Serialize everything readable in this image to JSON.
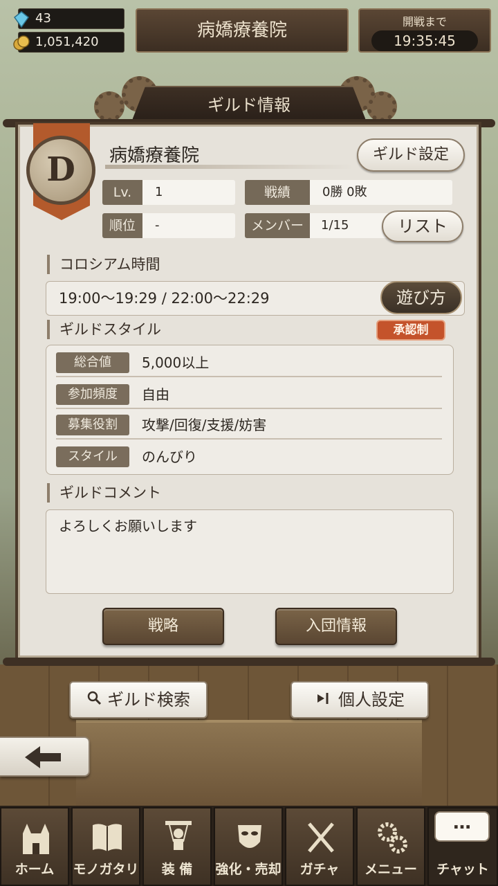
{
  "resources": {
    "gems": "43",
    "gold": "1,051,420"
  },
  "header": {
    "title": "病嬌療養院"
  },
  "timer": {
    "label": "開戦まで",
    "value": "19:35:45"
  },
  "panel": {
    "title": "ギルド情報",
    "rank": "D",
    "guild_name": "病嬌療養院",
    "settings_button": "ギルド設定",
    "stats": {
      "level_label": "Lv.",
      "level_value": "1",
      "record_label": "戦績",
      "record_value": "0勝 0敗",
      "rank_label": "順位",
      "rank_value": "-",
      "member_label": "メンバー",
      "member_value": "1/15"
    },
    "list_button": "リスト",
    "colosseum": {
      "title": "コロシアム時間",
      "times": "19:00〜19:29  /  22:00〜22:29",
      "howto_button": "遊び方"
    },
    "style": {
      "title": "ギルドスタイル",
      "badge": "承認制",
      "rows": [
        {
          "label": "総合値",
          "value": "5,000以上"
        },
        {
          "label": "参加頻度",
          "value": "自由"
        },
        {
          "label": "募集役割",
          "value": "攻撃/回復/支援/妨害"
        },
        {
          "label": "スタイル",
          "value": "のんびり"
        }
      ]
    },
    "comment": {
      "title": "ギルドコメント",
      "text": "よろしくお願いします"
    },
    "strategy_button": "戦略",
    "join_info_button": "入団情報"
  },
  "actions": {
    "search_button": "ギルド検索",
    "personal_button": "個人設定"
  },
  "nav": {
    "items": [
      {
        "label": "ホーム",
        "icon": "castle-icon"
      },
      {
        "label": "モノガタリ",
        "icon": "book-icon"
      },
      {
        "label": "装 備",
        "icon": "puppet-icon"
      },
      {
        "label": "強化・売却",
        "icon": "mask-icon"
      },
      {
        "label": "ガチャ",
        "icon": "crossed-swords-icon"
      },
      {
        "label": "メニュー",
        "icon": "gears-icon"
      },
      {
        "label": "チャット",
        "icon": "chat-bubble-icon"
      }
    ],
    "chat_bubble": "…"
  },
  "colors": {
    "panel": "#e6e2da",
    "accent_brown": "#5a4632",
    "badge": "#c4532b"
  }
}
